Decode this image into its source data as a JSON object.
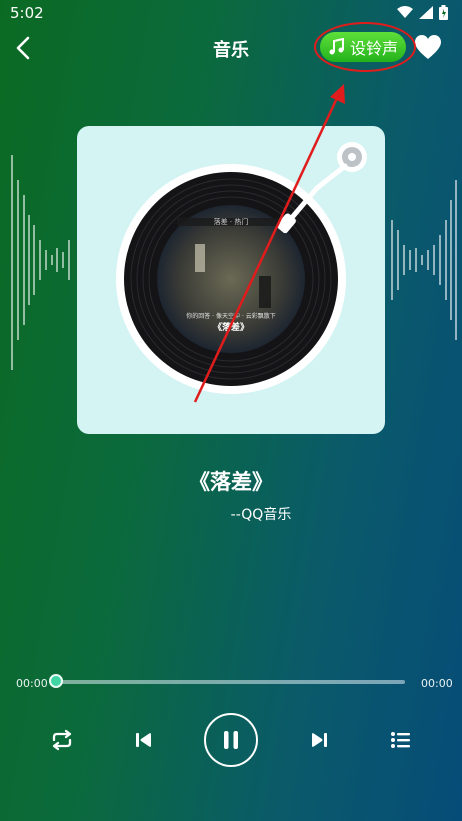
{
  "status": {
    "time": "5:02"
  },
  "header": {
    "title": "音乐",
    "ringtone_label": "设铃声"
  },
  "cover": {
    "caption_small": "你的回答 · 像天空中 · 云彩飘散下",
    "caption_title": "《落差》",
    "top_banner": "落差 · 热门"
  },
  "song": {
    "title": "《落差》",
    "artist": "--QQ音乐"
  },
  "player": {
    "current_time": "00:00",
    "total_time": "00:00",
    "progress": 0
  },
  "icons": [
    "back-arrow-icon",
    "music-note-icon",
    "heart-icon",
    "repeat-icon",
    "previous-icon",
    "pause-icon",
    "next-icon",
    "playlist-icon",
    "wifi-icon",
    "signal-icon",
    "battery-icon"
  ],
  "colors": {
    "accent": "#3fd6a4",
    "ringtone_green": "#23b21b",
    "annotation_red": "#e01c1c"
  }
}
